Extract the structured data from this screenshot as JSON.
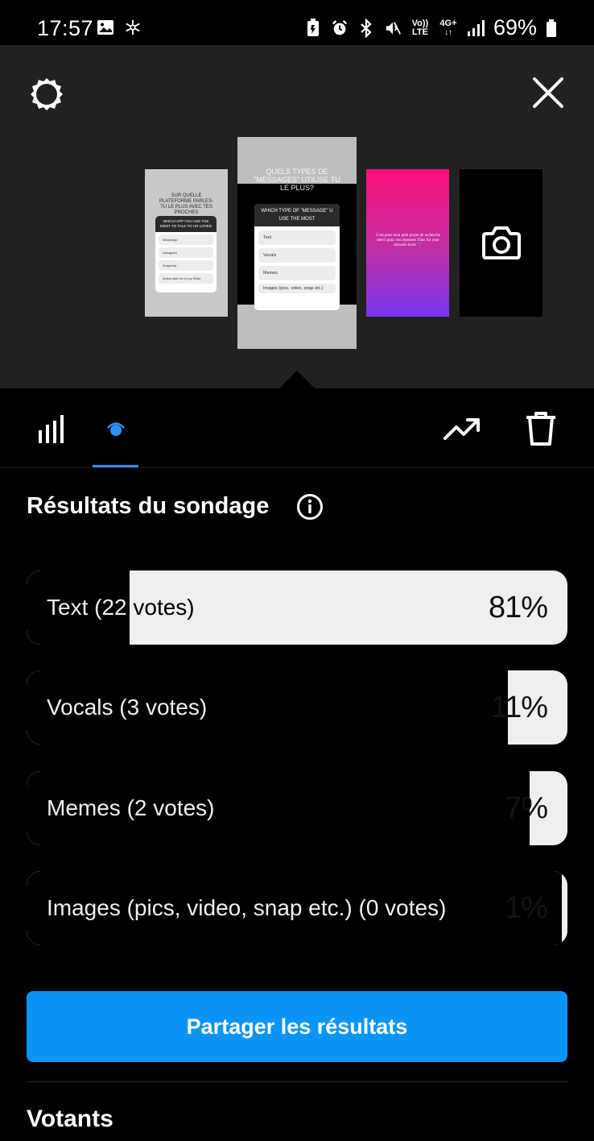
{
  "status_bar": {
    "time": "17:57",
    "network_top": "4G+",
    "volte_top": "Vo))",
    "volte_bottom": "LTE",
    "battery_percent": "69%",
    "icons": [
      "image-icon",
      "snowflake-icon",
      "battery-saver-icon",
      "alarm-icon",
      "bluetooth-icon",
      "mute-icon",
      "volte-icon",
      "4g-icon",
      "signal-icon",
      "battery-icon"
    ]
  },
  "story_tray": {
    "thumbnails": [
      {
        "question": "SUR QUELLE PLATEFORME PARLES-TU LE PLUS AVEC TES PROCHES",
        "card_title": "WHICH APP YOU USE THE MOST TO TALK TO UR LOVED",
        "options": [
          "WhatsApp",
          "Instagram",
          "Snapchat",
          "Autres (tell me in my DMs)"
        ]
      },
      {
        "question": "QUELS TYPES DE \"MESSAGES\" UTILISE TU LE PLUS?",
        "card_title": "WHICH TYPE OF \"MESSAGE\" U USE THE MOST",
        "options": [
          "Text",
          "Vocals",
          "Memes",
          "Images (pics, video, snap etc.)"
        ]
      },
      {
        "text": "C'est pour mon petit projet de recherche merci pour vos réponses Thks for your answers loves 💜"
      },
      {
        "icon": "camera-icon"
      }
    ]
  },
  "toolbar": {
    "left_tabs": [
      "bar-chart-icon",
      "eye-icon"
    ],
    "active_tab": "eye-icon",
    "right_actions": [
      "trend-icon",
      "trash-icon"
    ]
  },
  "poll": {
    "title": "Résultats du sondage",
    "options": [
      {
        "label": "Text (22 votes)",
        "percent": "81%",
        "value": 81
      },
      {
        "label": "Vocals (3 votes)",
        "percent": "11%",
        "value": 11
      },
      {
        "label": "Memes (2 votes)",
        "percent": "7%",
        "value": 7
      },
      {
        "label": "Images (pics, video, snap etc.) (0 votes)",
        "percent": "1%",
        "value": 1
      }
    ],
    "share_label": "Partager les résultats"
  },
  "voters": {
    "title": "Votants"
  },
  "colors": {
    "accent": "#0a95f6",
    "tab_underline": "#2f8ef5",
    "bar_track": "#efefef",
    "tray_bg": "#212121"
  }
}
